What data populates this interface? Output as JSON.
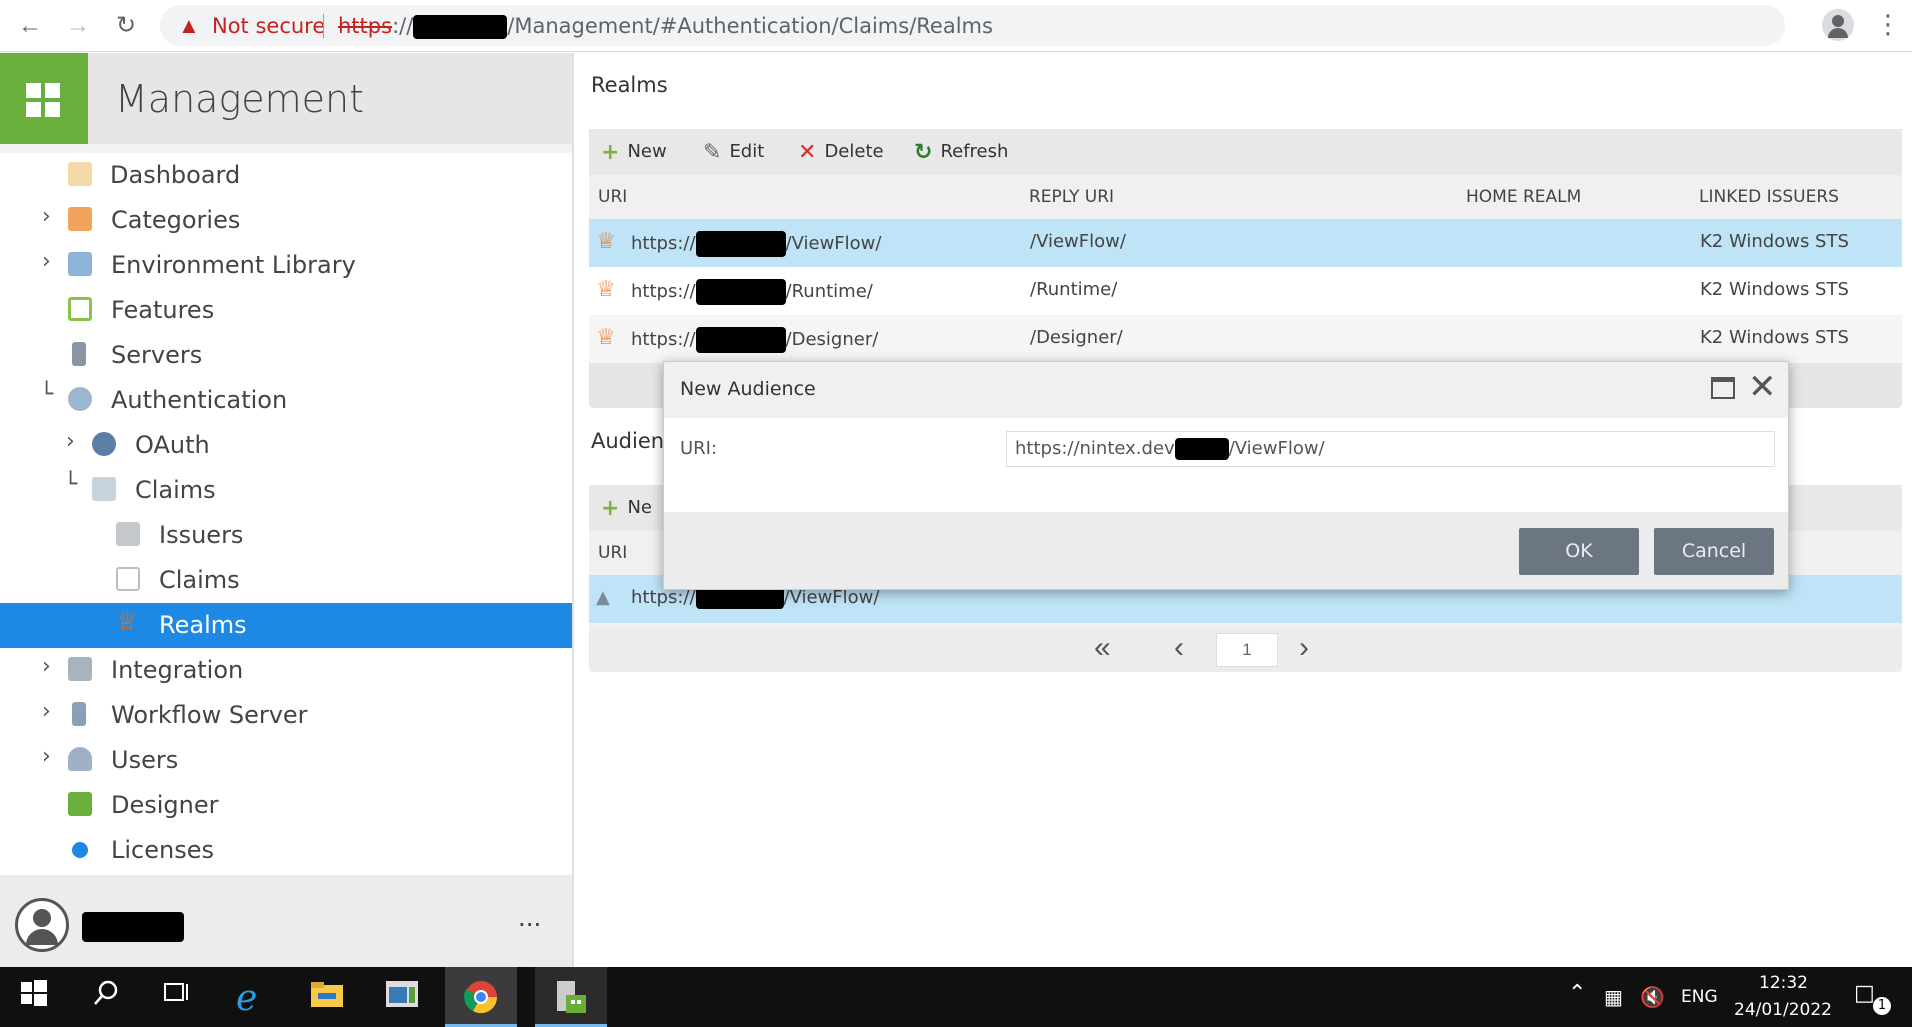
{
  "browser": {
    "security_label": "Not secure",
    "url_scheme": "https",
    "url_prefix": "://",
    "url_path": "/Management/#Authentication/Claims/Realms"
  },
  "app": {
    "title": "Management"
  },
  "sidebar": {
    "items": [
      {
        "label": "Dashboard",
        "icon": "dashboard-icon"
      },
      {
        "label": "Categories",
        "icon": "folder-icon"
      },
      {
        "label": "Environment Library",
        "icon": "library-icon"
      },
      {
        "label": "Features",
        "icon": "features-icon"
      },
      {
        "label": "Servers",
        "icon": "server-icon"
      },
      {
        "label": "Authentication",
        "icon": "key-icon"
      },
      {
        "label": "OAuth",
        "icon": "oauth-icon"
      },
      {
        "label": "Claims",
        "icon": "claims-icon"
      },
      {
        "label": "Issuers",
        "icon": "issuer-icon"
      },
      {
        "label": "Claims",
        "icon": "claim-card-icon"
      },
      {
        "label": "Realms",
        "icon": "crown-icon"
      },
      {
        "label": "Integration",
        "icon": "puzzle-icon"
      },
      {
        "label": "Workflow Server",
        "icon": "server-icon"
      },
      {
        "label": "Users",
        "icon": "user-icon"
      },
      {
        "label": "Designer",
        "icon": "designer-icon"
      },
      {
        "label": "Licenses",
        "icon": "license-icon"
      }
    ],
    "more_label": "..."
  },
  "realms": {
    "title": "Realms",
    "toolbar": {
      "new": "New",
      "edit": "Edit",
      "delete": "Delete",
      "refresh": "Refresh"
    },
    "columns": [
      "URI",
      "REPLY URI",
      "HOME REALM",
      "LINKED ISSUERS"
    ],
    "rows": [
      {
        "uri_prefix": "https://",
        "uri_suffix": "/ViewFlow/",
        "reply_uri": "/ViewFlow/",
        "home_realm": "",
        "linked_issuers": "K2 Windows STS"
      },
      {
        "uri_prefix": "https://",
        "uri_suffix": "/Runtime/",
        "reply_uri": "/Runtime/",
        "home_realm": "",
        "linked_issuers": "K2 Windows STS"
      },
      {
        "uri_prefix": "https://",
        "uri_suffix": "/Designer/",
        "reply_uri": "/Designer/",
        "home_realm": "",
        "linked_issuers": "K2 Windows STS"
      }
    ]
  },
  "audiences": {
    "title": "Audienc",
    "toolbar_new": "Ne",
    "columns": [
      "URI"
    ],
    "rows": [
      {
        "uri_prefix": "https://",
        "uri_suffix": "/ViewFlow/"
      }
    ],
    "pager": {
      "page": "1"
    }
  },
  "dialog": {
    "title": "New Audience",
    "uri_label": "URI:",
    "uri_prefix": "https://nintex.dev",
    "uri_suffix": "/ViewFlow/",
    "ok_label": "OK",
    "cancel_label": "Cancel"
  },
  "taskbar": {
    "language": "ENG",
    "time": "12:32",
    "date": "24/01/2022",
    "notifications": "1"
  },
  "colors": {
    "accent": "#1e88e5",
    "logo_green": "#6aae3c",
    "selected_row": "#bfe3f7",
    "crown": "#e8711a"
  }
}
